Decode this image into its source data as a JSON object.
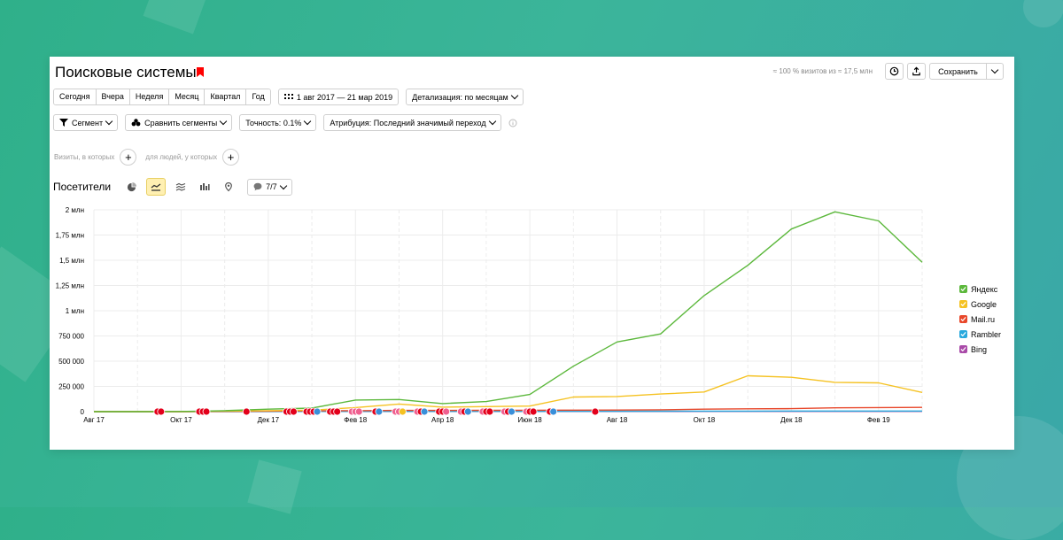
{
  "header": {
    "title": "Поисковые системы",
    "info": "≈ 100 % визитов из ≈ 17,5 млн",
    "save_label": "Сохранить"
  },
  "periods": [
    "Сегодня",
    "Вчера",
    "Неделя",
    "Месяц",
    "Квартал",
    "Год"
  ],
  "date_range": "1 авг 2017 — 21 мар 2019",
  "detail": "Детализация: по месяцам",
  "filters": {
    "segment": "Сегмент",
    "compare": "Сравнить сегменты",
    "accuracy": "Точность: 0.1%",
    "attribution": "Атрибуция: Последний значимый переход"
  },
  "conditions": {
    "visits": "Визиты, в которых",
    "people": "для людей, у которых"
  },
  "chart_header": {
    "title": "Посетители",
    "series_count": "7/7"
  },
  "colors": {
    "yandex": "#5cb83c",
    "google": "#f5c222",
    "mailru": "#e8472a",
    "rambler": "#29a9dd",
    "bing": "#a94aa8"
  },
  "chart_data": {
    "type": "line",
    "x": [
      "2017-08",
      "2017-09",
      "2017-10",
      "2017-11",
      "2017-12",
      "2018-01",
      "2018-02",
      "2018-03",
      "2018-04",
      "2018-05",
      "2018-06",
      "2018-07",
      "2018-08",
      "2018-09",
      "2018-10",
      "2018-11",
      "2018-12",
      "2019-01",
      "2019-02",
      "2019-03"
    ],
    "x_tick_labels": [
      "Авг 17",
      "Окт 17",
      "Дек 17",
      "Фев 18",
      "Апр 18",
      "Июн 18",
      "Авг 18",
      "Окт 18",
      "Дек 18",
      "Фев 19"
    ],
    "y_tick_labels": [
      "0",
      "250 000",
      "500 000",
      "750 000",
      "1 млн",
      "1,25 млн",
      "1,5 млн",
      "1,75 млн",
      "2 млн"
    ],
    "ylim": [
      0,
      2000000
    ],
    "series": [
      {
        "name": "Яндекс",
        "color": "#5cb83c",
        "values": [
          0,
          0,
          2000,
          10000,
          25000,
          35000,
          115000,
          120000,
          80000,
          100000,
          170000,
          450000,
          690000,
          770000,
          1150000,
          1450000,
          1810000,
          1980000,
          1890000,
          1480000
        ]
      },
      {
        "name": "Google",
        "color": "#f5c222",
        "values": [
          0,
          0,
          0,
          5000,
          10000,
          15000,
          40000,
          75000,
          45000,
          50000,
          55000,
          145000,
          150000,
          175000,
          195000,
          355000,
          340000,
          290000,
          285000,
          190000
        ]
      },
      {
        "name": "Mail.ru",
        "color": "#e8472a",
        "values": [
          0,
          0,
          0,
          3000,
          5000,
          8000,
          10000,
          12000,
          12000,
          13000,
          14000,
          15000,
          16000,
          18000,
          25000,
          28000,
          30000,
          38000,
          40000,
          42000
        ]
      },
      {
        "name": "Rambler",
        "color": "#29a9dd",
        "values": [
          0,
          0,
          0,
          1000,
          2000,
          2000,
          3000,
          3000,
          3000,
          3000,
          3000,
          4000,
          4000,
          4000,
          5000,
          5000,
          6000,
          6000,
          6000,
          6000
        ]
      },
      {
        "name": "Bing",
        "color": "#a94aa8",
        "values": [
          0,
          0,
          0,
          1000,
          1000,
          2000,
          2000,
          2000,
          2000,
          2000,
          2000,
          2000,
          2000,
          2000,
          3000,
          3000,
          3000,
          3000,
          3000,
          3000
        ]
      }
    ],
    "legend": [
      "Яндекс",
      "Google",
      "Mail.ru",
      "Rambler",
      "Bing"
    ],
    "legend_position": "right",
    "grid": true
  }
}
